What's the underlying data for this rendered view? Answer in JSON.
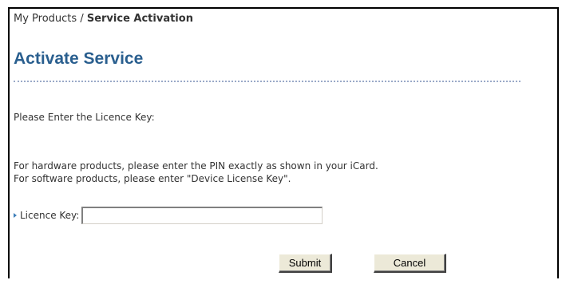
{
  "breadcrumb": {
    "parent": "My Products",
    "separator": " / ",
    "current": "Service Activation"
  },
  "page": {
    "title": "Activate Service",
    "prompt": "Please Enter the Licence Key:",
    "instruction_hardware": "For hardware products, please enter the PIN exactly as shown in your iCard.",
    "instruction_software": "For software products, please enter \"Device License Key\"."
  },
  "form": {
    "licence_key_label": "Licence Key:",
    "licence_key_value": "",
    "submit_label": "Submit",
    "cancel_label": "Cancel"
  },
  "colors": {
    "title": "#2a5f8f",
    "bullet": "#3f7fb9",
    "rule": "#9aaac8"
  }
}
